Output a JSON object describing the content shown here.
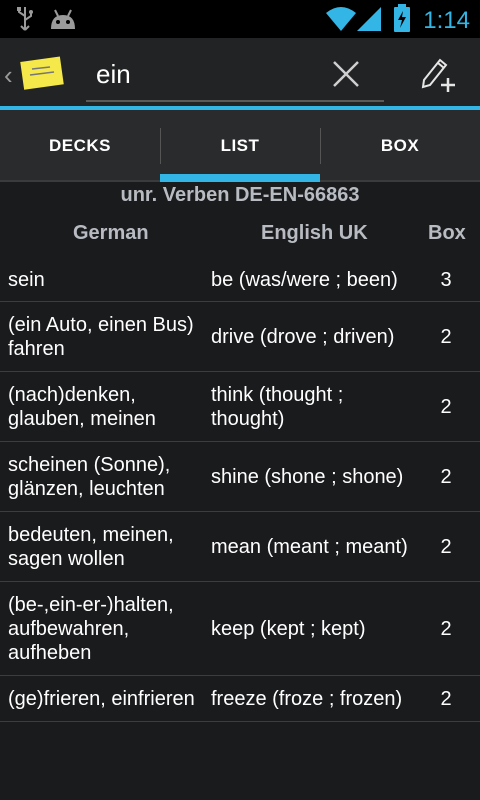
{
  "status_bar": {
    "time": "1:14"
  },
  "search": {
    "value": "ein"
  },
  "tabs": [
    {
      "label": "DECKS",
      "selected": false
    },
    {
      "label": "LIST",
      "selected": true
    },
    {
      "label": "BOX",
      "selected": false
    }
  ],
  "deck": {
    "title": "unr. Verben DE-EN-66863"
  },
  "columns": {
    "german": "German",
    "english": "English UK",
    "box": "Box"
  },
  "rows": [
    {
      "german": "sein",
      "english": "be (was/were ; been)",
      "box": "3"
    },
    {
      "german": "(ein Auto, einen Bus) fahren",
      "english": "drive (drove ; driven)",
      "box": "2"
    },
    {
      "german": "(nach)denken, glauben, meinen",
      "english": "think (thought ; thought)",
      "box": "2"
    },
    {
      "german": "scheinen (Sonne), glänzen, leuchten",
      "english": "shine (shone ; shone)",
      "box": "2"
    },
    {
      "german": "bedeuten, meinen, sagen wollen",
      "english": "mean (meant ; meant)",
      "box": "2"
    },
    {
      "german": "(be-,ein-er-)halten, aufbewahren, aufheben",
      "english": "keep (kept ; kept)",
      "box": "2"
    },
    {
      "german": "(ge)frieren, einfrieren",
      "english": "freeze (froze ; frozen)",
      "box": "2"
    }
  ],
  "colors": {
    "accent": "#33b5e5",
    "background": "#1a1b1d",
    "header_text": "#b8bcc2"
  },
  "icons": [
    "usb-icon",
    "android-icon",
    "wifi-icon",
    "signal-icon",
    "battery-charging-icon",
    "app-icon",
    "clear-icon",
    "add-card-icon"
  ]
}
